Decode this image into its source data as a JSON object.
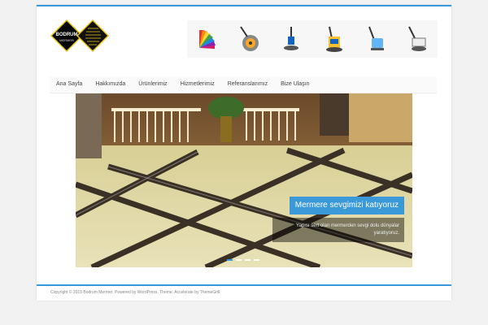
{
  "logo": {
    "name": "BODRUM",
    "subname": "MERMER",
    "tagline": "Mermer Kilim Cila Silim Lapatoz Zimpara Yüz Teri"
  },
  "banner": {
    "tools": [
      "color-swatches-icon",
      "floor-grinder-icon",
      "scrubber-machine-icon",
      "polisher-machine-icon",
      "sanding-machine-icon",
      "burnisher-machine-icon"
    ]
  },
  "nav": {
    "items": [
      {
        "label": "Ana Sayfa"
      },
      {
        "label": "Hakkımızda"
      },
      {
        "label": "Ürünlerimiz"
      },
      {
        "label": "Hizmetlerimiz"
      },
      {
        "label": "Referanslarımız"
      },
      {
        "label": "Bize Ulaşın"
      }
    ]
  },
  "slider": {
    "title": "Mermere sevgimizi katıyoruz",
    "description": "Yapısı sert olan mermerden sevgi dolu dünyalar yaratıyoruz.",
    "dots": 4,
    "active_dot": 1
  },
  "footer": {
    "copyright": "Copyright © 2015 Bodrum Mermer. Powered by WordPress. Theme: Accelerate by ThemeGrill."
  },
  "colors": {
    "accent": "#3a9ad9",
    "background": "#f2f2f2"
  }
}
